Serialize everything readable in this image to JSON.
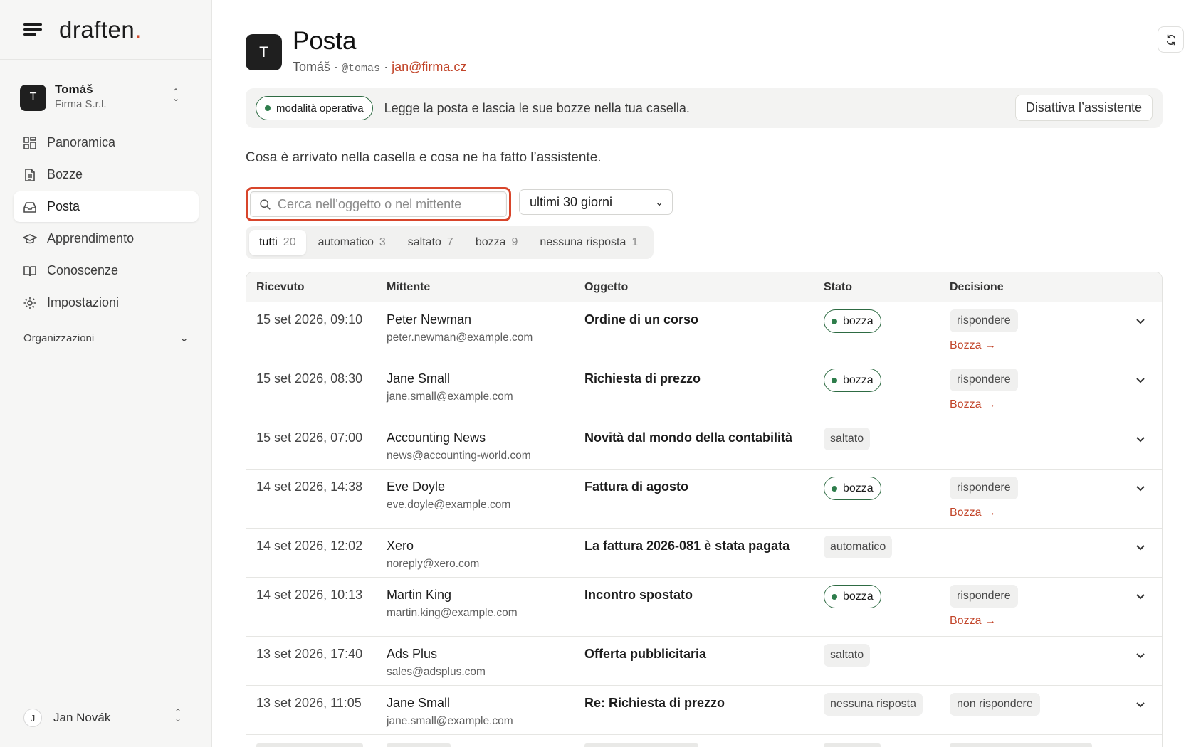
{
  "app": {
    "logo_text": "draften",
    "logo_dot": "."
  },
  "workspace": {
    "initial": "T",
    "name": "Tomáš",
    "company": "Firma S.r.l."
  },
  "nav": {
    "items": [
      {
        "label": "Panoramica",
        "icon": "dashboard-icon"
      },
      {
        "label": "Bozze",
        "icon": "document-icon"
      },
      {
        "label": "Posta",
        "icon": "inbox-icon",
        "active": true
      },
      {
        "label": "Apprendimento",
        "icon": "graduation-cap-icon"
      },
      {
        "label": "Conoscenze",
        "icon": "book-icon"
      },
      {
        "label": "Impostazioni",
        "icon": "gear-icon"
      }
    ],
    "organizations_label": "Organizzazioni"
  },
  "user": {
    "initial": "J",
    "name": "Jan Novák"
  },
  "header": {
    "avatar_initial": "T",
    "title": "Posta",
    "owner_name": "Tomáš",
    "sep1": "·",
    "handle": "@tomas",
    "sep2": "·",
    "email": "jan@firma.cz"
  },
  "mode_bar": {
    "pill_label": "modalità operativa",
    "description": "Legge la posta e lascia le sue bozze nella tua casella.",
    "deactivate_label": "Disattiva l’assistente"
  },
  "intro": "Cosa è arrivato nella casella e cosa ne ha fatto l’assistente.",
  "search": {
    "placeholder": "Cerca nell’oggetto o nel mittente",
    "value": ""
  },
  "period": {
    "selected": "ultimi 30 giorni"
  },
  "filters": [
    {
      "label": "tutti",
      "count": "20",
      "active": true
    },
    {
      "label": "automatico",
      "count": "3"
    },
    {
      "label": "saltato",
      "count": "7"
    },
    {
      "label": "bozza",
      "count": "9"
    },
    {
      "label": "nessuna risposta",
      "count": "1"
    }
  ],
  "table": {
    "headers": {
      "received": "Ricevuto",
      "sender": "Mittente",
      "subject": "Oggetto",
      "status": "Stato",
      "decision": "Decisione"
    },
    "rows": [
      {
        "received": "15 set 2026, 09:10",
        "sender_name": "Peter Newman",
        "sender_email": "peter.newman@example.com",
        "subject": "Ordine di un corso",
        "status": "bozza",
        "decision": "rispondere",
        "link": "Bozza →"
      },
      {
        "received": "15 set 2026, 08:30",
        "sender_name": "Jane Small",
        "sender_email": "jane.small@example.com",
        "subject": "Richiesta di prezzo",
        "status": "bozza",
        "decision": "rispondere",
        "link": "Bozza →"
      },
      {
        "received": "15 set 2026, 07:00",
        "sender_name": "Accounting News",
        "sender_email": "news@accounting-world.com",
        "subject": "Novità dal mondo della contabilità",
        "status": "saltato",
        "decision": "",
        "link": ""
      },
      {
        "received": "14 set 2026, 14:38",
        "sender_name": "Eve Doyle",
        "sender_email": "eve.doyle@example.com",
        "subject": "Fattura di agosto",
        "status": "bozza",
        "decision": "rispondere",
        "link": "Bozza →"
      },
      {
        "received": "14 set 2026, 12:02",
        "sender_name": "Xero",
        "sender_email": "noreply@xero.com",
        "subject": "La fattura 2026-081 è stata pagata",
        "status": "automatico",
        "decision": "",
        "link": ""
      },
      {
        "received": "14 set 2026, 10:13",
        "sender_name": "Martin King",
        "sender_email": "martin.king@example.com",
        "subject": "Incontro spostato",
        "status": "bozza",
        "decision": "rispondere",
        "link": "Bozza →"
      },
      {
        "received": "13 set 2026, 17:40",
        "sender_name": "Ads Plus",
        "sender_email": "sales@adsplus.com",
        "subject": "Offerta pubblicitaria",
        "status": "saltato",
        "decision": "",
        "link": ""
      },
      {
        "received": "13 set 2026, 11:05",
        "sender_name": "Jane Small",
        "sender_email": "jane.small@example.com",
        "subject": "Re: Richiesta di prezzo",
        "status": "nessuna risposta",
        "decision": "non rispondere",
        "link": ""
      }
    ]
  }
}
